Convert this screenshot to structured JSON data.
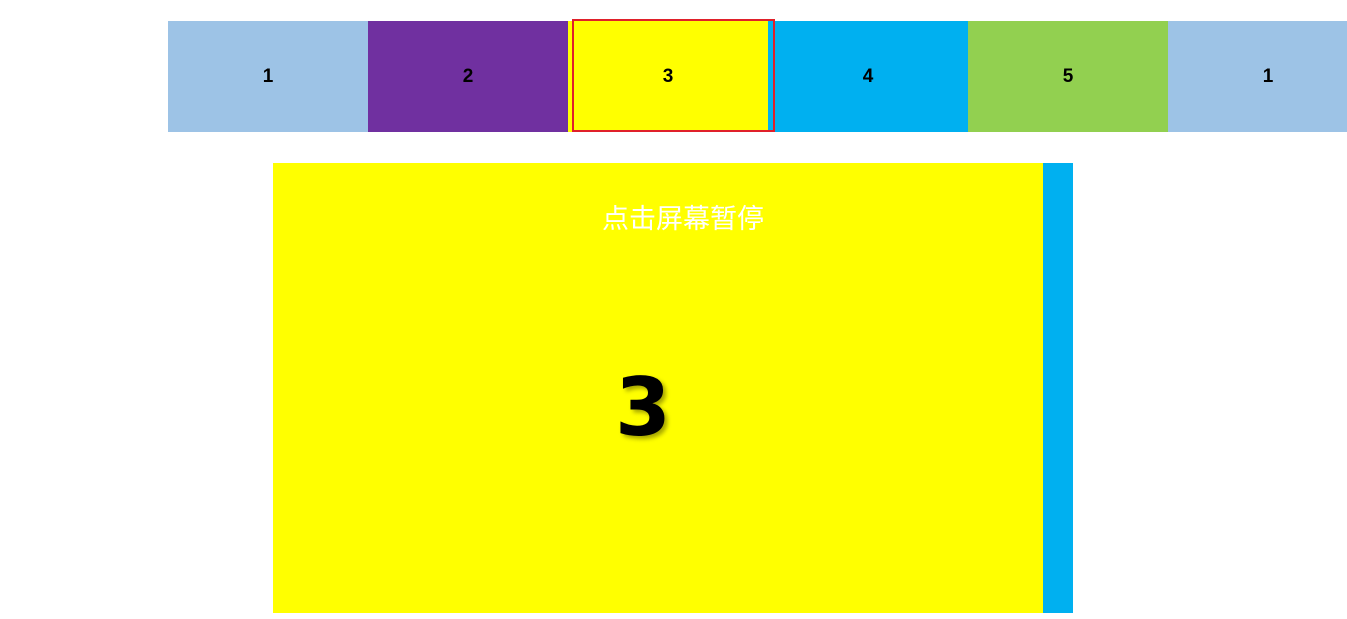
{
  "thumbnails": [
    {
      "label": "1",
      "color": "#9dc3e6"
    },
    {
      "label": "2",
      "color": "#7030a0"
    },
    {
      "label": "3",
      "color": "#ffff00"
    },
    {
      "label": "4",
      "color": "#00b0f0"
    },
    {
      "label": "5",
      "color": "#92d050"
    },
    {
      "label": "1",
      "color": "#9dc3e6"
    }
  ],
  "active_index": 2,
  "active_frame_color": "#e0202a",
  "stage": {
    "pause_hint": "点击屏幕暂停",
    "current_label": "3",
    "current_color": "#ffff00",
    "next_color": "#00b0f0"
  }
}
